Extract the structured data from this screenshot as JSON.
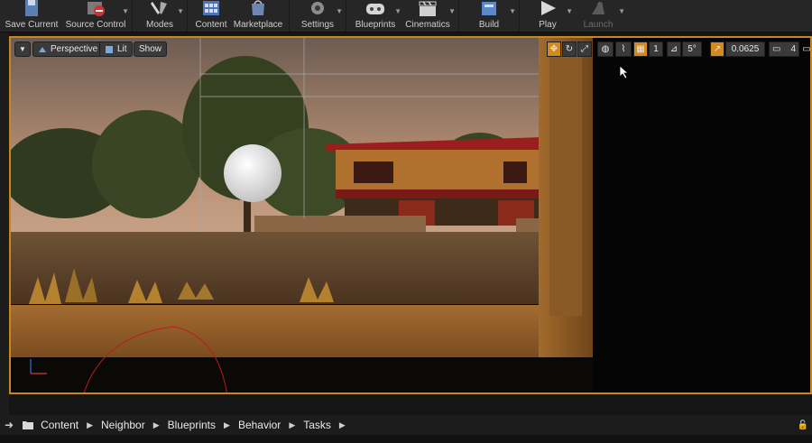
{
  "toolbar": {
    "save_current": "Save Current",
    "source_control": "Source Control",
    "modes": "Modes",
    "content": "Content",
    "marketplace": "Marketplace",
    "settings": "Settings",
    "blueprints": "Blueprints",
    "cinematics": "Cinematics",
    "build": "Build",
    "play": "Play",
    "launch": "Launch"
  },
  "viewport": {
    "perspective": "Perspective",
    "lit": "Lit",
    "show": "Show",
    "grid_snap_value": "1",
    "rotation_snap_value": "5°",
    "scale_snap_value": "0.0625",
    "camera_speed_value": "4"
  },
  "pathbar": {
    "items": [
      "Content",
      "Neighbor",
      "Blueprints",
      "Behavior",
      "Tasks"
    ]
  },
  "colors": {
    "accent": "#c8861d",
    "toolbar_bg": "#262626",
    "pathbar_bg": "#1c1c1c"
  }
}
